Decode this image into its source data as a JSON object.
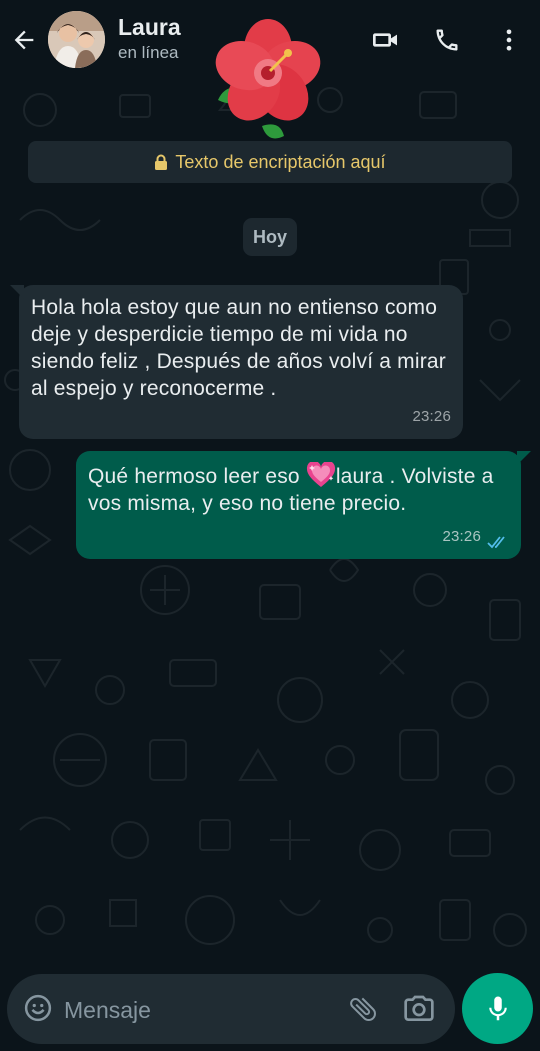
{
  "header": {
    "contact_name": "Laura",
    "contact_status": "en línea"
  },
  "encryption": {
    "text": "Texto de encriptación aquí"
  },
  "date_chip": "Hoy",
  "messages": [
    {
      "direction": "in",
      "text": " Hola hola estoy que aun no entienso como deje y desperdicie tiempo de mi vida no siendo feliz , Después de años volví a mirar al espejo y reconocerme .",
      "time": "23:26"
    },
    {
      "direction": "out",
      "text_before": "Qué hermoso leer eso ",
      "text_after": "laura . Volviste a vos misma, y eso no tiene precio.",
      "time": "23:26",
      "status": "read"
    }
  ],
  "composer": {
    "placeholder": "Mensaje"
  },
  "icons": {
    "back": "arrow-left-icon",
    "video": "video-call-icon",
    "phone": "phone-icon",
    "menu": "more-vertical-icon",
    "lock": "lock-icon",
    "emoji": "emoji-icon",
    "attach": "paperclip-icon",
    "camera": "camera-icon",
    "mic": "microphone-icon",
    "heart": "sparkling-heart-icon",
    "ticks": "double-check-icon",
    "flower": "hibiscus-icon"
  },
  "colors": {
    "background": "#0b141a",
    "incoming_bubble": "#202c33",
    "outgoing_bubble": "#005c4b",
    "accent": "#00a884",
    "encryption_text": "#e6c76a",
    "read_ticks": "#53bdeb"
  }
}
